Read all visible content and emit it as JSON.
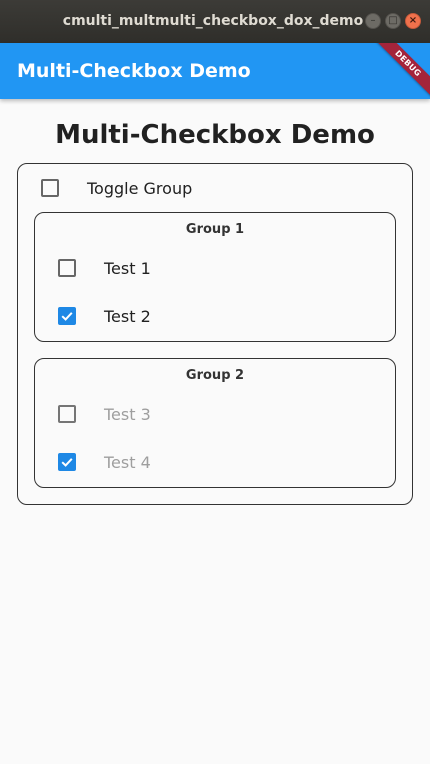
{
  "window": {
    "title": "cmulti_multmulti_checkbox_dox_demo",
    "minimize_glyph": "–",
    "maximize_glyph": "□",
    "close_glyph": "×"
  },
  "appbar": {
    "title": "Multi-Checkbox Demo",
    "debug_label": "DEBUG",
    "color": "#2196f3"
  },
  "page": {
    "heading": "Multi-Checkbox Demo",
    "toggle": {
      "label": "Toggle Group",
      "checked": false
    },
    "groups": [
      {
        "title": "Group 1",
        "items": [
          {
            "label": "Test 1",
            "checked": false,
            "enabled": true
          },
          {
            "label": "Test 2",
            "checked": true,
            "enabled": true
          }
        ]
      },
      {
        "title": "Group 2",
        "items": [
          {
            "label": "Test 3",
            "checked": false,
            "enabled": false
          },
          {
            "label": "Test 4",
            "checked": true,
            "enabled": false
          }
        ]
      }
    ]
  },
  "colors": {
    "accent": "#1e88e5",
    "disabled_text": "#9e9e9e"
  }
}
